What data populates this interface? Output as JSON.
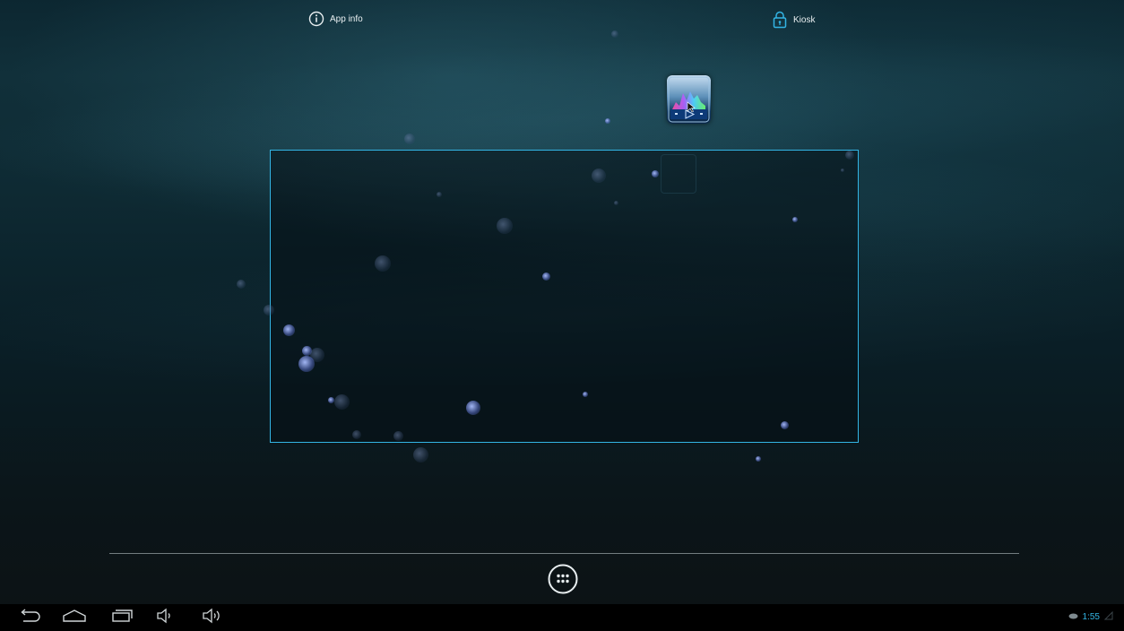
{
  "top_bar": {
    "app_info_label": "App info",
    "kiosk_label": "Kiosk",
    "app_info_icon": "info-icon",
    "kiosk_icon": "lock-icon"
  },
  "dragged_app": {
    "icon": "music-visualizer-app-icon"
  },
  "widget": {
    "type": "live-wallpaper-bokeh-widget"
  },
  "hotseat": {
    "all_apps_icon": "all-apps-icon"
  },
  "nav_bar": {
    "buttons": [
      "back",
      "home",
      "recent-apps",
      "volume-down",
      "volume-up"
    ],
    "time": "1:55"
  },
  "colors": {
    "accent": "#33b5e5",
    "background": "#0c2731",
    "text": "#e8eef0"
  }
}
